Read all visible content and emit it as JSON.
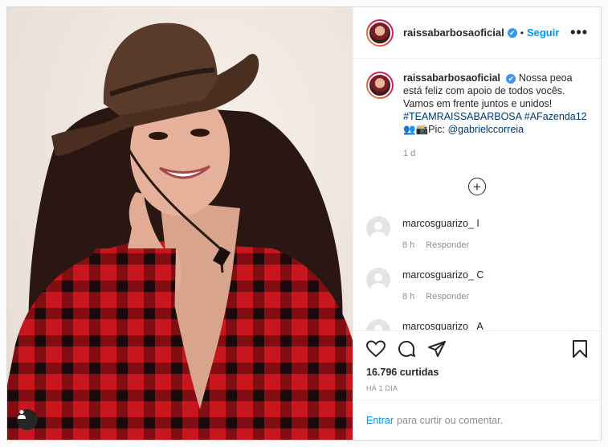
{
  "post": {
    "username": "raissabarbosaoficial",
    "verified_mark": "✔",
    "dot": "•",
    "follow_label": "Seguir",
    "more_label": "•••",
    "image_alt": "Woman in cowboy hat and red plaid shirt giving thumbs up"
  },
  "caption": {
    "username": "raissabarbosaoficial",
    "text": "Nossa peoa está feliz com apoio de todos vocês. Vamos em frente juntos e unidos!",
    "hashtag1": "#TEAMRAISSABARBOSA",
    "hashtag2": "#AFazenda12",
    "credit_prefix": "👥📸Pic:",
    "credit_user": "@gabrielccorreia",
    "age": "1 d"
  },
  "load_more_label": "+",
  "comments": [
    {
      "user": "marcosguarizo_",
      "text": "I",
      "time": "8 h",
      "reply": "Responder"
    },
    {
      "user": "marcosguarizo_",
      "text": "C",
      "time": "8 h",
      "reply": "Responder"
    },
    {
      "user": "marcosguarizo_",
      "text": "A",
      "time": "",
      "reply": ""
    }
  ],
  "actions": {
    "like_icon": "heart-icon",
    "comment_icon": "comment-icon",
    "share_icon": "share-icon",
    "save_icon": "bookmark-icon",
    "likes": "16.796 curtidas",
    "date": "HÁ 1 DIA"
  },
  "footer": {
    "enter_label": "Entrar",
    "rest_label": "para curtir ou comentar."
  },
  "colors": {
    "accent": "#0095f6",
    "verified": "#3897f0",
    "shirt_red": "#c8161f",
    "hat_brown": "#5a3a28"
  }
}
